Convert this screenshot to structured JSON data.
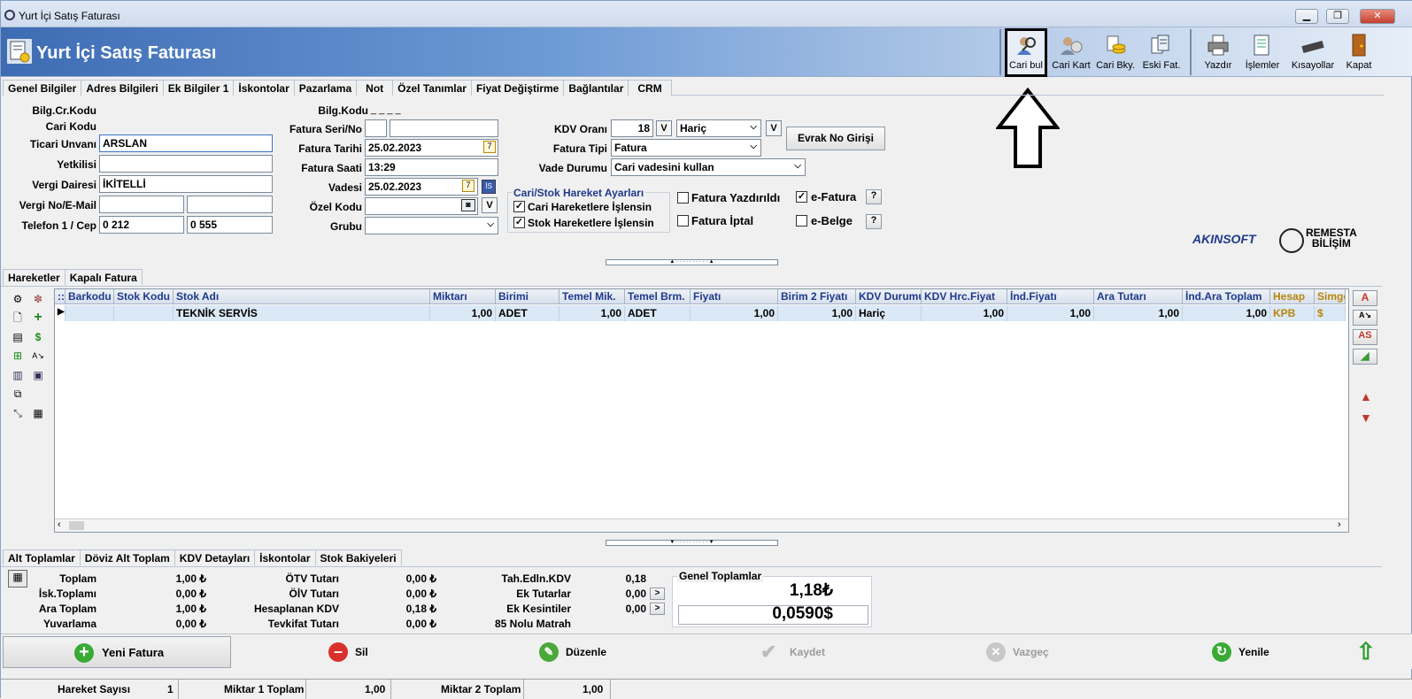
{
  "window": {
    "title": "Yurt İçi Satış Faturası"
  },
  "header": {
    "title": "Yurt İçi Satış Faturası"
  },
  "toolbar": {
    "items": [
      {
        "label": "Cari bul",
        "icon": "search-person-icon"
      },
      {
        "label": "Cari Kart",
        "icon": "person-card-icon"
      },
      {
        "label": "Cari Bky.",
        "icon": "coins-icon"
      },
      {
        "label": "Eski Fat.",
        "icon": "documents-icon"
      },
      {
        "label": "Yazdır",
        "icon": "printer-icon"
      },
      {
        "label": "İşlemler",
        "icon": "list-icon"
      },
      {
        "label": "Kısayollar",
        "icon": "keyboard-icon"
      },
      {
        "label": "Kapat",
        "icon": "door-icon"
      }
    ]
  },
  "top_tabs": [
    "Genel Bilgiler",
    "Adres Bilgileri",
    "Ek Bilgiler 1",
    "İskontolar",
    "Pazarlama",
    "Not",
    "Özel Tanımlar",
    "Fiyat Değiştirme",
    "Bağlantılar",
    "CRM"
  ],
  "form": {
    "bilg_cr_kodu_label": "Bilg.Cr.Kodu",
    "cari_kodu_label": "Cari Kodu",
    "ticari_unvani_label": "Ticari Unvanı",
    "ticari_unvani_value": "ARSLAN",
    "yetkilisi_label": "Yetkilisi",
    "vergi_dairesi_label": "Vergi Dairesi",
    "vergi_dairesi_value": "İKİTELLİ",
    "vergi_no_label": "Vergi No/E-Mail",
    "telefon_label": "Telefon 1 / Cep",
    "telefon1_value": "0 212",
    "cep_value": "0 555",
    "bilg_kodu_label": "Bilg.Kodu",
    "bilg_kodu_value": "_ _ _ _",
    "fatura_seri_label": "Fatura Seri/No",
    "fatura_tarihi_label": "Fatura Tarihi",
    "fatura_tarihi_value": "25.02.2023",
    "fatura_saati_label": "Fatura Saati",
    "fatura_saati_value": "13:29",
    "vadesi_label": "Vadesi",
    "vadesi_value": "25.02.2023",
    "ozel_kodu_label": "Özel Kodu",
    "grubu_label": "Grubu",
    "kdv_orani_label": "KDV Oranı",
    "kdv_orani_value": "18",
    "kdv_tip_value": "Hariç",
    "fatura_tipi_label": "Fatura Tipi",
    "fatura_tipi_value": "Fatura",
    "vade_durumu_label": "Vade Durumu",
    "vade_durumu_value": "Cari vadesini kullan",
    "evrak_no_button": "Evrak No Girişi",
    "v_label": "V",
    "cal_label": "7",
    "is_label": "İS",
    "cari_stok_group": "Cari/Stok Hareket Ayarları",
    "cari_hareket_label": "Cari Hareketlere İşlensin",
    "stok_hareket_label": "Stok Hareketlere İşlensin",
    "fatura_yazdirildi_label": "Fatura Yazdırıldı",
    "fatura_iptal_label": "Fatura İptal",
    "e_fatura_label": "e-Fatura",
    "e_belge_label": "e-Belge",
    "help_label": "?"
  },
  "logos": {
    "akinsoft": "AKINSOFT",
    "remesta_line1": "REMESTA",
    "remesta_line2": "BİLİŞİM"
  },
  "movement_tabs": [
    "Hareketler",
    "Kapalı Fatura"
  ],
  "grid": {
    "columns": [
      "::",
      "Barkodu",
      "Stok Kodu",
      "Stok Adı",
      "Miktarı",
      "Birimi",
      "Temel Mik.",
      "Temel Brm.",
      "Fiyatı",
      "Birim 2 Fiyatı",
      "KDV Durumu",
      "KDV Hrc.Fiyat",
      "İnd.Fiyatı",
      "Ara Tutarı",
      "İnd.Ara Toplam",
      "Hesap",
      "Simge"
    ],
    "rows": [
      [
        "▶",
        "",
        "",
        "TEKNİK SERVİS",
        "1,00",
        "ADET",
        "1,00",
        "ADET",
        "1,00",
        "1,00",
        "Hariç",
        "1,00",
        "1,00",
        "1,00",
        "1,00",
        "KPB",
        "$"
      ]
    ]
  },
  "right_panel": {
    "a_label": "A",
    "as_label": "AS"
  },
  "bottom_tabs": [
    "Alt Toplamlar",
    "Döviz Alt Toplam",
    "KDV Detayları",
    "İskontolar",
    "Stok Bakiyeleri"
  ],
  "totals": {
    "col1": [
      {
        "label": "Toplam",
        "value": "1,00 ₺"
      },
      {
        "label": "İsk.Toplamı",
        "value": "0,00 ₺"
      },
      {
        "label": "Ara Toplam",
        "value": "1,00 ₺"
      },
      {
        "label": "Yuvarlama",
        "value": "0,00 ₺"
      }
    ],
    "col2": [
      {
        "label": "ÖTV Tutarı",
        "value": "0,00 ₺"
      },
      {
        "label": "ÖİV Tutarı",
        "value": "0,00 ₺"
      },
      {
        "label": "Hesaplanan KDV",
        "value": "0,18 ₺"
      },
      {
        "label": "Tevkifat Tutarı",
        "value": "0,00 ₺"
      }
    ],
    "col3": [
      {
        "label": "Tah.Edln.KDV",
        "value": "0,18"
      },
      {
        "label": "Ek Tutarlar",
        "value": "0,00"
      },
      {
        "label": "Ek Kesintiler",
        "value": "0,00"
      },
      {
        "label": "85 Nolu Matrah",
        "value": ""
      }
    ],
    "genel_label": "Genel Toplamlar",
    "genel_tl": "1,18₺",
    "genel_usd": "0,0590$",
    "arrow_label": ">"
  },
  "actions": {
    "yeni": "Yeni Fatura",
    "sil": "Sil",
    "duzenle": "Düzenle",
    "kaydet": "Kaydet",
    "vazgec": "Vazgeç",
    "yenile": "Yenile"
  },
  "status": {
    "hareket_label": "Hareket Sayısı",
    "hareket_value": "1",
    "miktar1_label": "Miktar 1 Toplam",
    "miktar1_value": "1,00",
    "miktar2_label": "Miktar 2 Toplam",
    "miktar2_value": "1,00"
  },
  "colors": {
    "header_blue": "#3d6cb4",
    "grid_header_text": "#1e3a8a",
    "grid_row": "#dbe8f6",
    "hesap": "#b8860b"
  }
}
